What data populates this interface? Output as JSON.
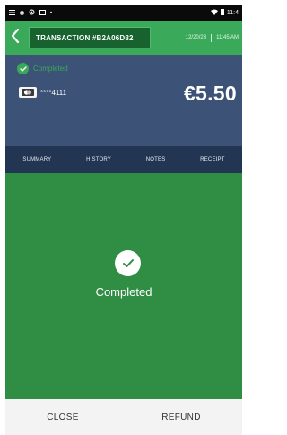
{
  "status_bar": {
    "time": "11:4"
  },
  "header": {
    "transaction_label": "TRANSACTION #B2A06D82",
    "date": "12/20/23",
    "time": "11:45 AM"
  },
  "summary": {
    "status": "Completed",
    "card_number": "****4111",
    "amount": "€5.50"
  },
  "tabs": [
    "SUMMARY",
    "HISTORY",
    "NOTES",
    "RECEIPT"
  ],
  "main": {
    "status_text": "Completed"
  },
  "footer": {
    "close_label": "CLOSE",
    "refund_label": "REFUND"
  },
  "colors": {
    "header_green": "#3aaa5a",
    "summary_blue": "#3c5277",
    "tab_bar": "#223654",
    "success_green": "#2f8d44"
  }
}
